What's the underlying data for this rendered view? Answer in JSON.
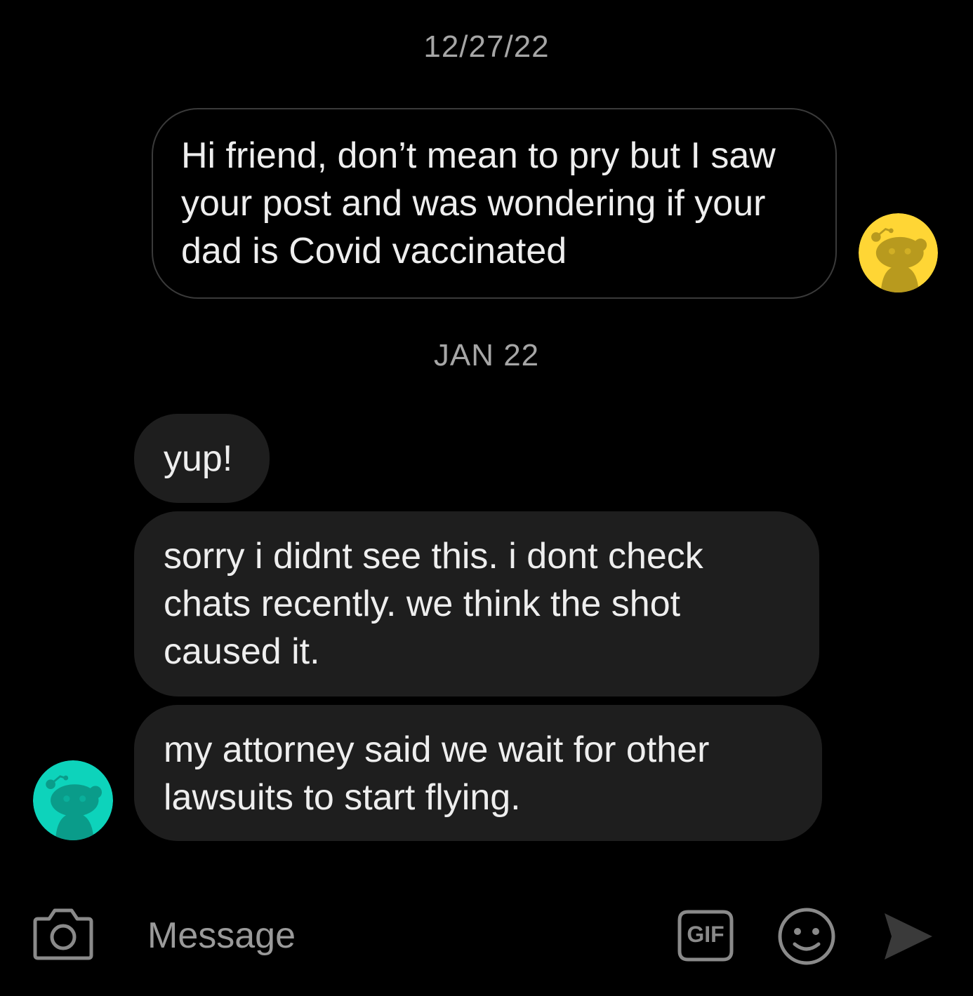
{
  "conversation": {
    "date_separators": [
      "12/27/22",
      "JAN 22"
    ],
    "messages": [
      {
        "sender": "me",
        "text": "Hi friend, don’t mean to pry but I saw your post and was wondering if your dad is Covid vaccinated"
      },
      {
        "sender": "other",
        "text": "yup!"
      },
      {
        "sender": "other",
        "text": "sorry i didnt see this. i dont check chats recently. we think the shot caused it."
      },
      {
        "sender": "other",
        "text": "my attorney said we wait for other lawsuits to start flying."
      }
    ]
  },
  "avatars": {
    "me": {
      "color": "#ffd635",
      "shade": "#b89a1e",
      "icon": "snoo-avatar-icon"
    },
    "other": {
      "color": "#0dd3bb",
      "shade": "#0a9c8a",
      "icon": "snoo-avatar-icon"
    }
  },
  "composer": {
    "placeholder": "Message",
    "gif_label": "GIF",
    "icons": [
      "camera-icon",
      "gif-icon",
      "emoji-icon",
      "send-icon"
    ]
  },
  "colors": {
    "background": "#000000",
    "incoming_bubble": "#1e1e1e",
    "outgoing_border": "#3a3a3a",
    "timestamp": "#a6a6a6",
    "icon": "#8a8a8a"
  }
}
